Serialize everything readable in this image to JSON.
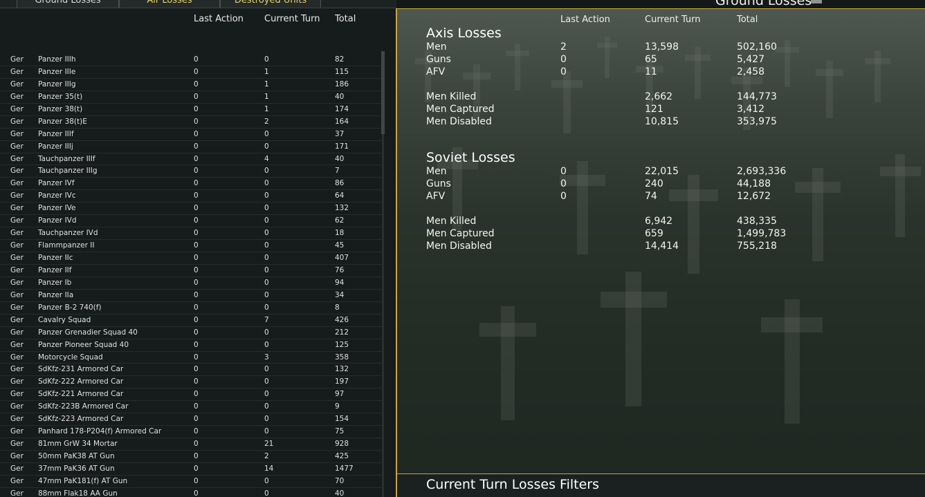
{
  "tabs": [
    "Ground Losses",
    "Air Losses",
    "Destroyed Units"
  ],
  "left": {
    "headers": [
      "Last Action",
      "Current Turn",
      "Total"
    ],
    "rows": [
      [
        "Ger",
        "Panzer IIIh",
        "0",
        "0",
        "82"
      ],
      [
        "Ger",
        "Panzer IIIe",
        "0",
        "1",
        "115"
      ],
      [
        "Ger",
        "Panzer IIIg",
        "0",
        "1",
        "186"
      ],
      [
        "Ger",
        "Panzer 35(t)",
        "0",
        "1",
        "40"
      ],
      [
        "Ger",
        "Panzer 38(t)",
        "0",
        "1",
        "174"
      ],
      [
        "Ger",
        "Panzer 38(t)E",
        "0",
        "2",
        "164"
      ],
      [
        "Ger",
        "Panzer IIIf",
        "0",
        "0",
        "37"
      ],
      [
        "Ger",
        "Panzer IIIj",
        "0",
        "0",
        "171"
      ],
      [
        "Ger",
        "Tauchpanzer IIIf",
        "0",
        "4",
        "40"
      ],
      [
        "Ger",
        "Tauchpanzer IIIg",
        "0",
        "0",
        "7"
      ],
      [
        "Ger",
        "Panzer IVf",
        "0",
        "0",
        "86"
      ],
      [
        "Ger",
        "Panzer IVc",
        "0",
        "0",
        "64"
      ],
      [
        "Ger",
        "Panzer IVe",
        "0",
        "0",
        "132"
      ],
      [
        "Ger",
        "Panzer IVd",
        "0",
        "0",
        "62"
      ],
      [
        "Ger",
        "Tauchpanzer IVd",
        "0",
        "0",
        "18"
      ],
      [
        "Ger",
        "Flammpanzer II",
        "0",
        "0",
        "45"
      ],
      [
        "Ger",
        "Panzer IIc",
        "0",
        "0",
        "407"
      ],
      [
        "Ger",
        "Panzer IIf",
        "0",
        "0",
        "76"
      ],
      [
        "Ger",
        "Panzer Ib",
        "0",
        "0",
        "94"
      ],
      [
        "Ger",
        "Panzer IIa",
        "0",
        "0",
        "34"
      ],
      [
        "Ger",
        "Panzer B-2 740(f)",
        "0",
        "0",
        "8"
      ],
      [
        "Ger",
        "Cavalry Squad",
        "0",
        "7",
        "426"
      ],
      [
        "Ger",
        "Panzer Grenadier Squad 40",
        "0",
        "0",
        "212"
      ],
      [
        "Ger",
        "Panzer Pioneer Squad 40",
        "0",
        "0",
        "125"
      ],
      [
        "Ger",
        "Motorcycle Squad",
        "0",
        "3",
        "358"
      ],
      [
        "Ger",
        "SdKfz-231 Armored Car",
        "0",
        "0",
        "132"
      ],
      [
        "Ger",
        "SdKfz-222 Armored Car",
        "0",
        "0",
        "197"
      ],
      [
        "Ger",
        "SdKfz-221 Armored Car",
        "0",
        "0",
        "97"
      ],
      [
        "Ger",
        "SdKfz-223B Armored Car",
        "0",
        "0",
        "9"
      ],
      [
        "Ger",
        "SdKfz-223 Armored Car",
        "0",
        "0",
        "154"
      ],
      [
        "Ger",
        "Panhard 178-P204(f) Armored Car",
        "0",
        "0",
        "75"
      ],
      [
        "Ger",
        "81mm GrW 34 Mortar",
        "0",
        "21",
        "928"
      ],
      [
        "Ger",
        "50mm PaK38 AT Gun",
        "0",
        "2",
        "425"
      ],
      [
        "Ger",
        "37mm PaK36 AT Gun",
        "0",
        "14",
        "1477"
      ],
      [
        "Ger",
        "47mm PaK181(f) AT Gun",
        "0",
        "0",
        "70"
      ],
      [
        "Ger",
        "88mm Flak18 AA Gun",
        "0",
        "0",
        "40"
      ]
    ]
  },
  "right": {
    "title": "Ground Losses",
    "headers": [
      "Last Action",
      "Current Turn",
      "Total"
    ],
    "axis": {
      "title": "Axis Losses",
      "rows": [
        [
          "Men",
          "2",
          "13,598",
          "502,160"
        ],
        [
          "Guns",
          "0",
          "65",
          "5,427"
        ],
        [
          "AFV",
          "0",
          "11",
          "2,458"
        ]
      ],
      "rows2": [
        [
          "Men Killed",
          "",
          "2,662",
          "144,773"
        ],
        [
          "Men Captured",
          "",
          "121",
          "3,412"
        ],
        [
          "Men Disabled",
          "",
          "10,815",
          "353,975"
        ]
      ]
    },
    "soviet": {
      "title": "Soviet Losses",
      "rows": [
        [
          "Men",
          "0",
          "22,015",
          "2,693,336"
        ],
        [
          "Guns",
          "0",
          "240",
          "44,188"
        ],
        [
          "AFV",
          "0",
          "74",
          "12,672"
        ]
      ],
      "rows2": [
        [
          "Men Killed",
          "",
          "6,942",
          "438,335"
        ],
        [
          "Men Captured",
          "",
          "659",
          "1,499,783"
        ],
        [
          "Men Disabled",
          "",
          "14,414",
          "755,218"
        ]
      ]
    },
    "filters_title": "Current Turn Losses Filters"
  }
}
